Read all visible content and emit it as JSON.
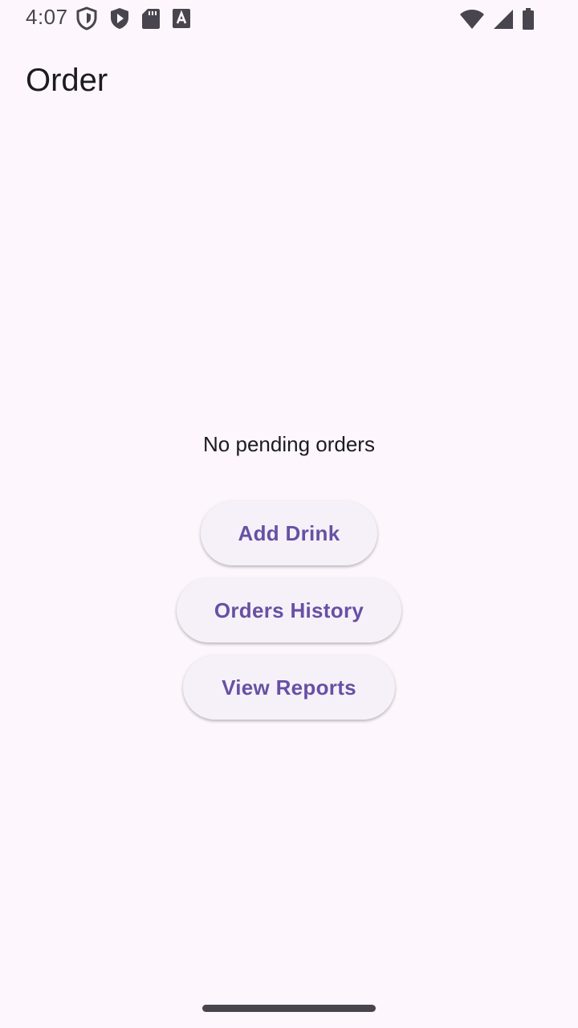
{
  "status_bar": {
    "time": "4:07",
    "left_icons": [
      "shield-outline-icon",
      "play-shield-icon",
      "sd-card-icon",
      "font-a-icon"
    ],
    "right_icons": [
      "wifi-icon",
      "signal-icon",
      "battery-icon"
    ]
  },
  "app_bar": {
    "title": "Order"
  },
  "main": {
    "empty_message": "No pending orders",
    "buttons": {
      "add_drink": "Add Drink",
      "orders_history": "Orders History",
      "view_reports": "View Reports"
    }
  },
  "colors": {
    "background": "#fdf7fd",
    "button_background": "#f6f1f8",
    "accent": "#6750a4",
    "text": "#1d1b20"
  }
}
